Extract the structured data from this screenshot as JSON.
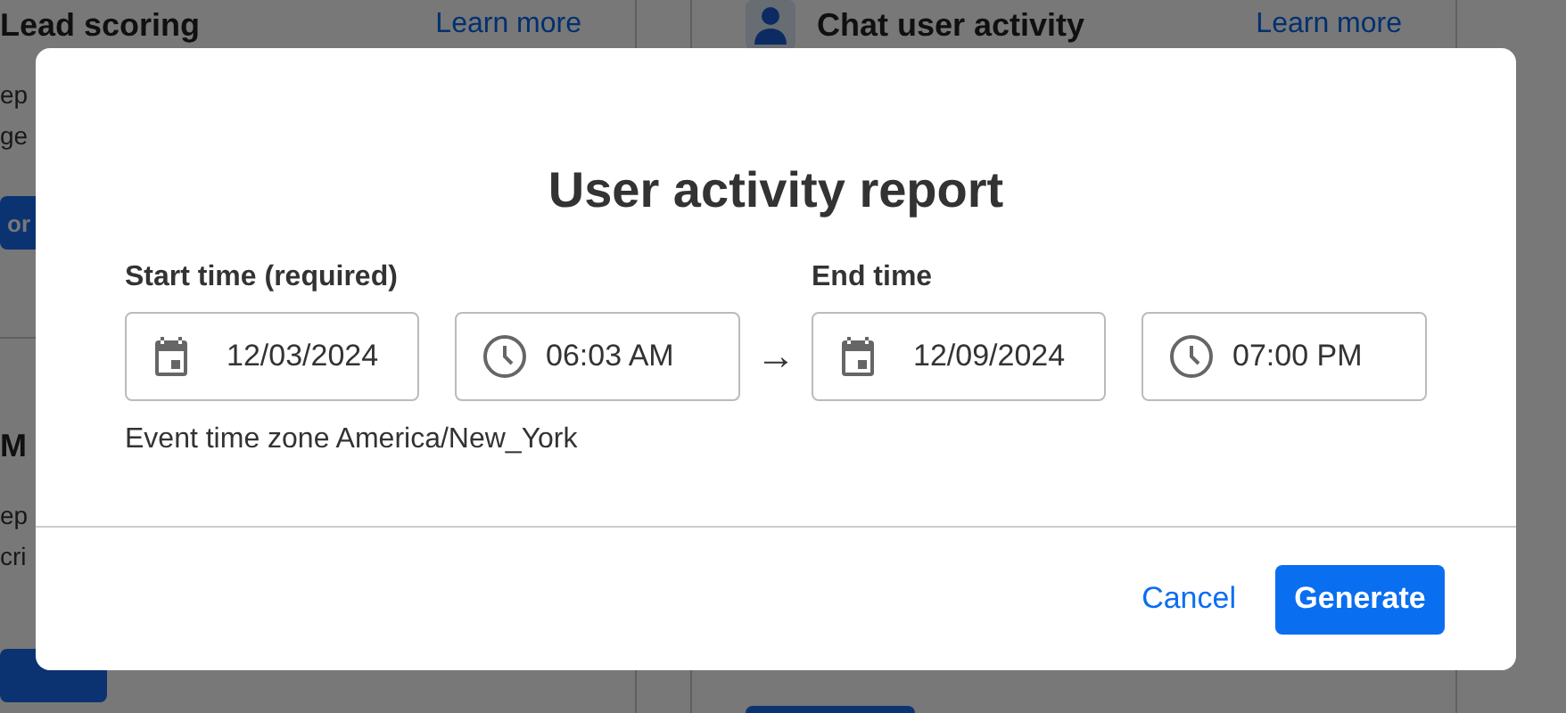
{
  "background": {
    "cards": [
      {
        "title": "Lead scoring",
        "link": "Learn more",
        "description": [
          "ep",
          "ge"
        ],
        "button": "or"
      },
      {
        "title": "Chat user activity",
        "link": "Learn more",
        "has_icon": true
      },
      {
        "title": "M",
        "description": [
          "ep",
          "cri"
        ],
        "button_shown": true
      }
    ]
  },
  "dialog": {
    "title": "User activity report",
    "start": {
      "label": "Start time (required)",
      "date": "12/03/2024",
      "time": "06:03 AM"
    },
    "end": {
      "label": "End time",
      "date": "12/09/2024",
      "time": "07:00 PM"
    },
    "arrow": "→",
    "timezone_note": "Event time zone America/New_York",
    "buttons": [
      {
        "label": "Cancel",
        "kind": "link"
      },
      {
        "label": "Generate",
        "kind": "primary"
      }
    ]
  }
}
